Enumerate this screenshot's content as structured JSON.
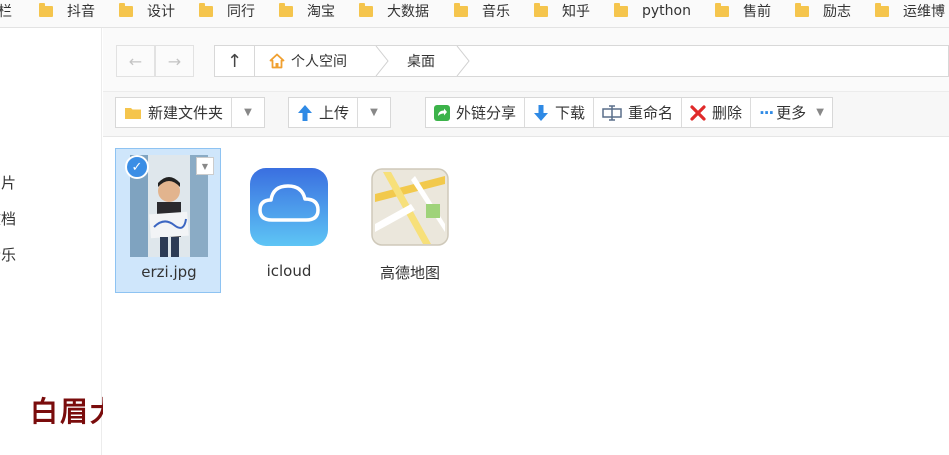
{
  "bookmarks": [
    "栏",
    "抖音",
    "设计",
    "同行",
    "淘宝",
    "大数据",
    "音乐",
    "知乎",
    "python",
    "售前",
    "励志",
    "运维博"
  ],
  "sidebar": {
    "items": [
      "图片",
      "文档",
      "音乐"
    ]
  },
  "watermark": "白眉大叔",
  "nav": {
    "back_icon": "←",
    "forward_icon": "→",
    "up_icon": "↑",
    "crumbs": [
      "个人空间",
      "桌面"
    ]
  },
  "toolbar": {
    "new_folder": "新建文件夹",
    "upload": "上传",
    "share": "外链分享",
    "download": "下载",
    "rename": "重命名",
    "delete": "删除",
    "more": "更多"
  },
  "files": [
    {
      "name": "erzi.jpg",
      "selected": true
    },
    {
      "name": "icloud",
      "selected": false
    },
    {
      "name": "高德地图",
      "selected": false
    }
  ],
  "colors": {
    "selection_bg": "#cfe6fb",
    "accent": "#3b8ee5",
    "watermark": "#7a0c0c"
  }
}
